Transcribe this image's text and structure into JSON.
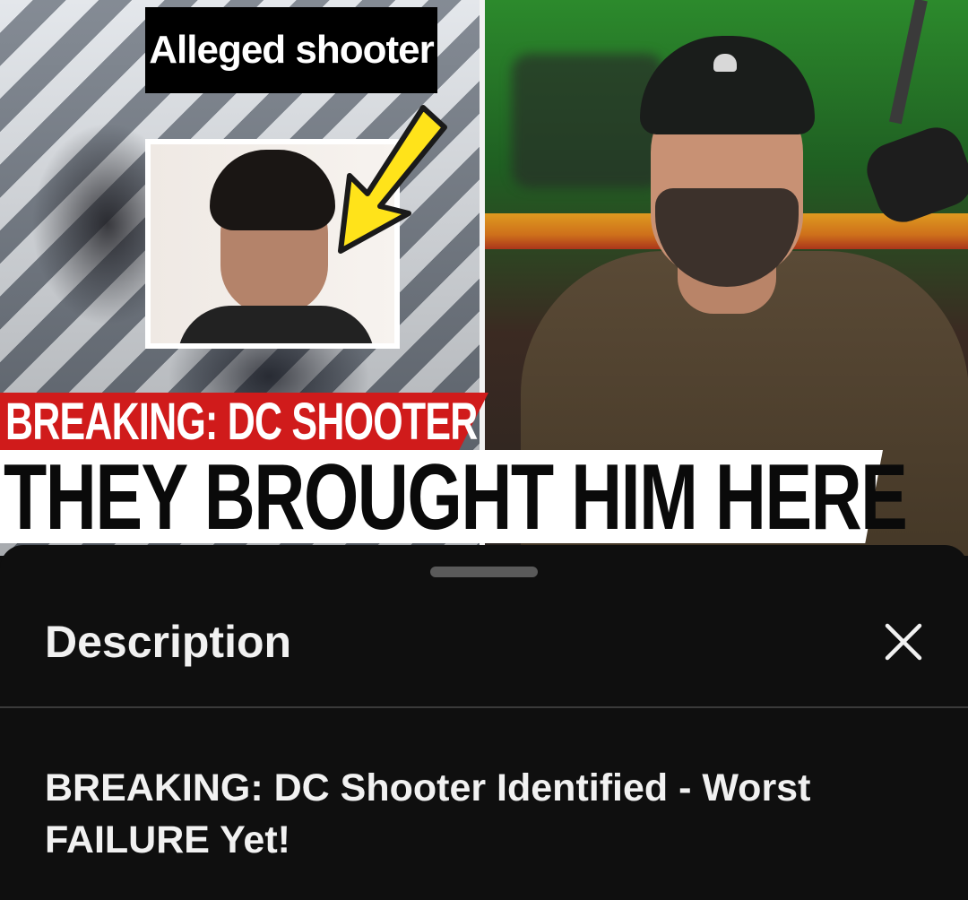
{
  "thumbnail": {
    "chip_label": "Alleged shooter",
    "headline_top": "BREAKING: DC SHOOTER",
    "headline_bottom": "THEY BROUGHT HIM HERE",
    "colors": {
      "headline_red": "#d01b1b",
      "arrow_yellow": "#ffe31a",
      "studio_green": "#2c8a2c"
    }
  },
  "description_sheet": {
    "title": "Description",
    "close_icon": "close-icon",
    "video_title": "BREAKING: DC Shooter Identified - Worst FAILURE Yet!"
  }
}
